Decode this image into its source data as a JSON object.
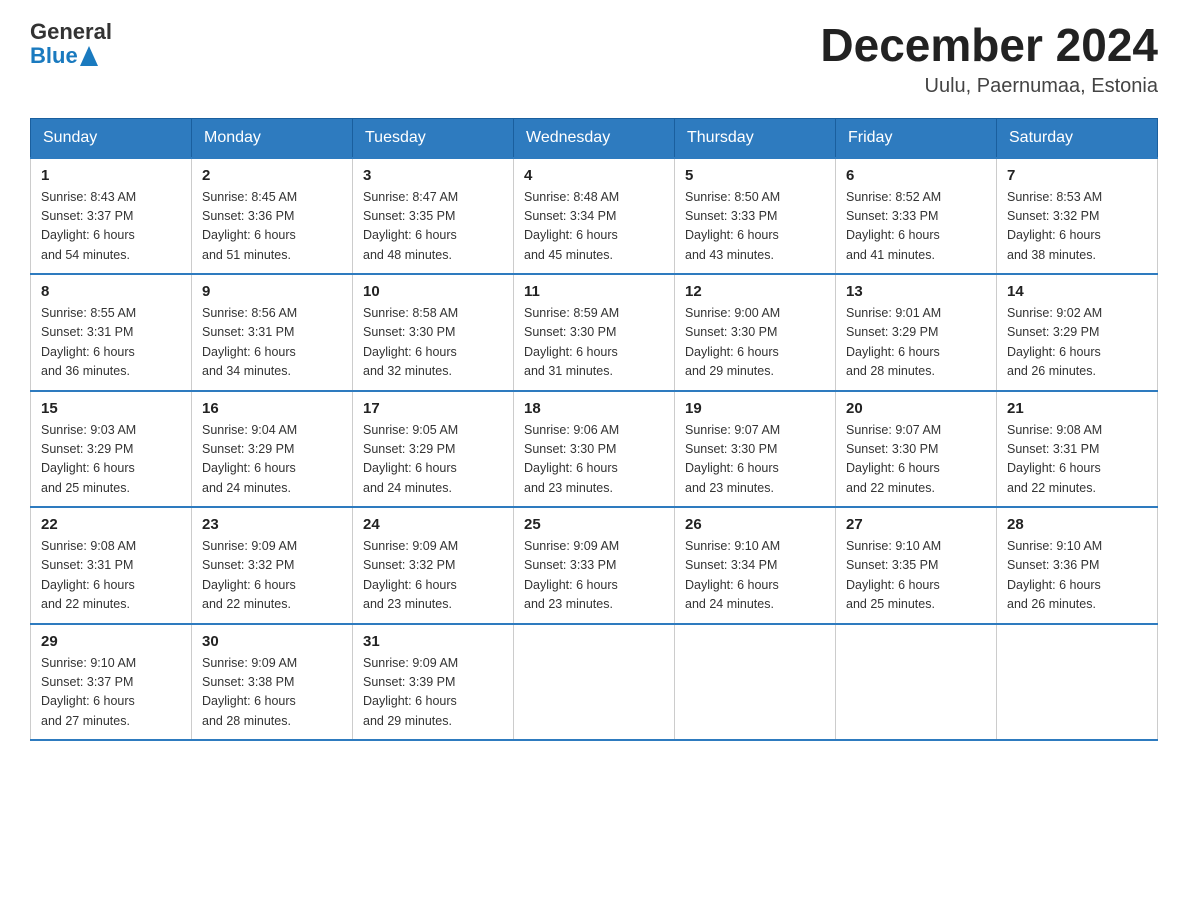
{
  "header": {
    "logo_general": "General",
    "logo_blue": "Blue",
    "month_title": "December 2024",
    "location": "Uulu, Paernumaa, Estonia"
  },
  "weekdays": [
    "Sunday",
    "Monday",
    "Tuesday",
    "Wednesday",
    "Thursday",
    "Friday",
    "Saturday"
  ],
  "weeks": [
    [
      {
        "day": "1",
        "sunrise": "8:43 AM",
        "sunset": "3:37 PM",
        "daylight": "6 hours and 54 minutes."
      },
      {
        "day": "2",
        "sunrise": "8:45 AM",
        "sunset": "3:36 PM",
        "daylight": "6 hours and 51 minutes."
      },
      {
        "day": "3",
        "sunrise": "8:47 AM",
        "sunset": "3:35 PM",
        "daylight": "6 hours and 48 minutes."
      },
      {
        "day": "4",
        "sunrise": "8:48 AM",
        "sunset": "3:34 PM",
        "daylight": "6 hours and 45 minutes."
      },
      {
        "day": "5",
        "sunrise": "8:50 AM",
        "sunset": "3:33 PM",
        "daylight": "6 hours and 43 minutes."
      },
      {
        "day": "6",
        "sunrise": "8:52 AM",
        "sunset": "3:33 PM",
        "daylight": "6 hours and 41 minutes."
      },
      {
        "day": "7",
        "sunrise": "8:53 AM",
        "sunset": "3:32 PM",
        "daylight": "6 hours and 38 minutes."
      }
    ],
    [
      {
        "day": "8",
        "sunrise": "8:55 AM",
        "sunset": "3:31 PM",
        "daylight": "6 hours and 36 minutes."
      },
      {
        "day": "9",
        "sunrise": "8:56 AM",
        "sunset": "3:31 PM",
        "daylight": "6 hours and 34 minutes."
      },
      {
        "day": "10",
        "sunrise": "8:58 AM",
        "sunset": "3:30 PM",
        "daylight": "6 hours and 32 minutes."
      },
      {
        "day": "11",
        "sunrise": "8:59 AM",
        "sunset": "3:30 PM",
        "daylight": "6 hours and 31 minutes."
      },
      {
        "day": "12",
        "sunrise": "9:00 AM",
        "sunset": "3:30 PM",
        "daylight": "6 hours and 29 minutes."
      },
      {
        "day": "13",
        "sunrise": "9:01 AM",
        "sunset": "3:29 PM",
        "daylight": "6 hours and 28 minutes."
      },
      {
        "day": "14",
        "sunrise": "9:02 AM",
        "sunset": "3:29 PM",
        "daylight": "6 hours and 26 minutes."
      }
    ],
    [
      {
        "day": "15",
        "sunrise": "9:03 AM",
        "sunset": "3:29 PM",
        "daylight": "6 hours and 25 minutes."
      },
      {
        "day": "16",
        "sunrise": "9:04 AM",
        "sunset": "3:29 PM",
        "daylight": "6 hours and 24 minutes."
      },
      {
        "day": "17",
        "sunrise": "9:05 AM",
        "sunset": "3:29 PM",
        "daylight": "6 hours and 24 minutes."
      },
      {
        "day": "18",
        "sunrise": "9:06 AM",
        "sunset": "3:30 PM",
        "daylight": "6 hours and 23 minutes."
      },
      {
        "day": "19",
        "sunrise": "9:07 AM",
        "sunset": "3:30 PM",
        "daylight": "6 hours and 23 minutes."
      },
      {
        "day": "20",
        "sunrise": "9:07 AM",
        "sunset": "3:30 PM",
        "daylight": "6 hours and 22 minutes."
      },
      {
        "day": "21",
        "sunrise": "9:08 AM",
        "sunset": "3:31 PM",
        "daylight": "6 hours and 22 minutes."
      }
    ],
    [
      {
        "day": "22",
        "sunrise": "9:08 AM",
        "sunset": "3:31 PM",
        "daylight": "6 hours and 22 minutes."
      },
      {
        "day": "23",
        "sunrise": "9:09 AM",
        "sunset": "3:32 PM",
        "daylight": "6 hours and 22 minutes."
      },
      {
        "day": "24",
        "sunrise": "9:09 AM",
        "sunset": "3:32 PM",
        "daylight": "6 hours and 23 minutes."
      },
      {
        "day": "25",
        "sunrise": "9:09 AM",
        "sunset": "3:33 PM",
        "daylight": "6 hours and 23 minutes."
      },
      {
        "day": "26",
        "sunrise": "9:10 AM",
        "sunset": "3:34 PM",
        "daylight": "6 hours and 24 minutes."
      },
      {
        "day": "27",
        "sunrise": "9:10 AM",
        "sunset": "3:35 PM",
        "daylight": "6 hours and 25 minutes."
      },
      {
        "day": "28",
        "sunrise": "9:10 AM",
        "sunset": "3:36 PM",
        "daylight": "6 hours and 26 minutes."
      }
    ],
    [
      {
        "day": "29",
        "sunrise": "9:10 AM",
        "sunset": "3:37 PM",
        "daylight": "6 hours and 27 minutes."
      },
      {
        "day": "30",
        "sunrise": "9:09 AM",
        "sunset": "3:38 PM",
        "daylight": "6 hours and 28 minutes."
      },
      {
        "day": "31",
        "sunrise": "9:09 AM",
        "sunset": "3:39 PM",
        "daylight": "6 hours and 29 minutes."
      },
      null,
      null,
      null,
      null
    ]
  ]
}
